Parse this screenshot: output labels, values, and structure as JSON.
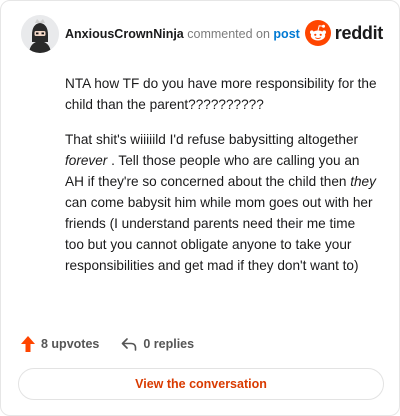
{
  "header": {
    "username": "AnxiousCrownNinja",
    "commented_text": "commented on",
    "post_link": "post",
    "brand": "reddit"
  },
  "comment": {
    "paragraph1": "NTA how TF do you have more responsibility for the child than the parent??????????",
    "p2_part1": "That shit's wiiiiild I'd refuse babysitting altogether ",
    "p2_em1": "forever",
    "p2_part2": " . Tell those people who are calling you an AH if they're so concerned about the child then ",
    "p2_em2": "they",
    "p2_part3": " can come babysit him while mom goes out with her friends (I understand parents need their me time too but you cannot obligate anyone to take your responsibilities and get mad if they don't want to)"
  },
  "footer": {
    "upvotes": "8 upvotes",
    "replies": "0 replies",
    "view_button": "View the conversation"
  },
  "colors": {
    "brand_orange": "#ff4500",
    "link_blue": "#0079d3",
    "button_text": "#d93a00"
  },
  "icons": [
    "avatar",
    "reddit-logo-icon",
    "upvote-arrow-icon",
    "reply-arrow-icon"
  ]
}
